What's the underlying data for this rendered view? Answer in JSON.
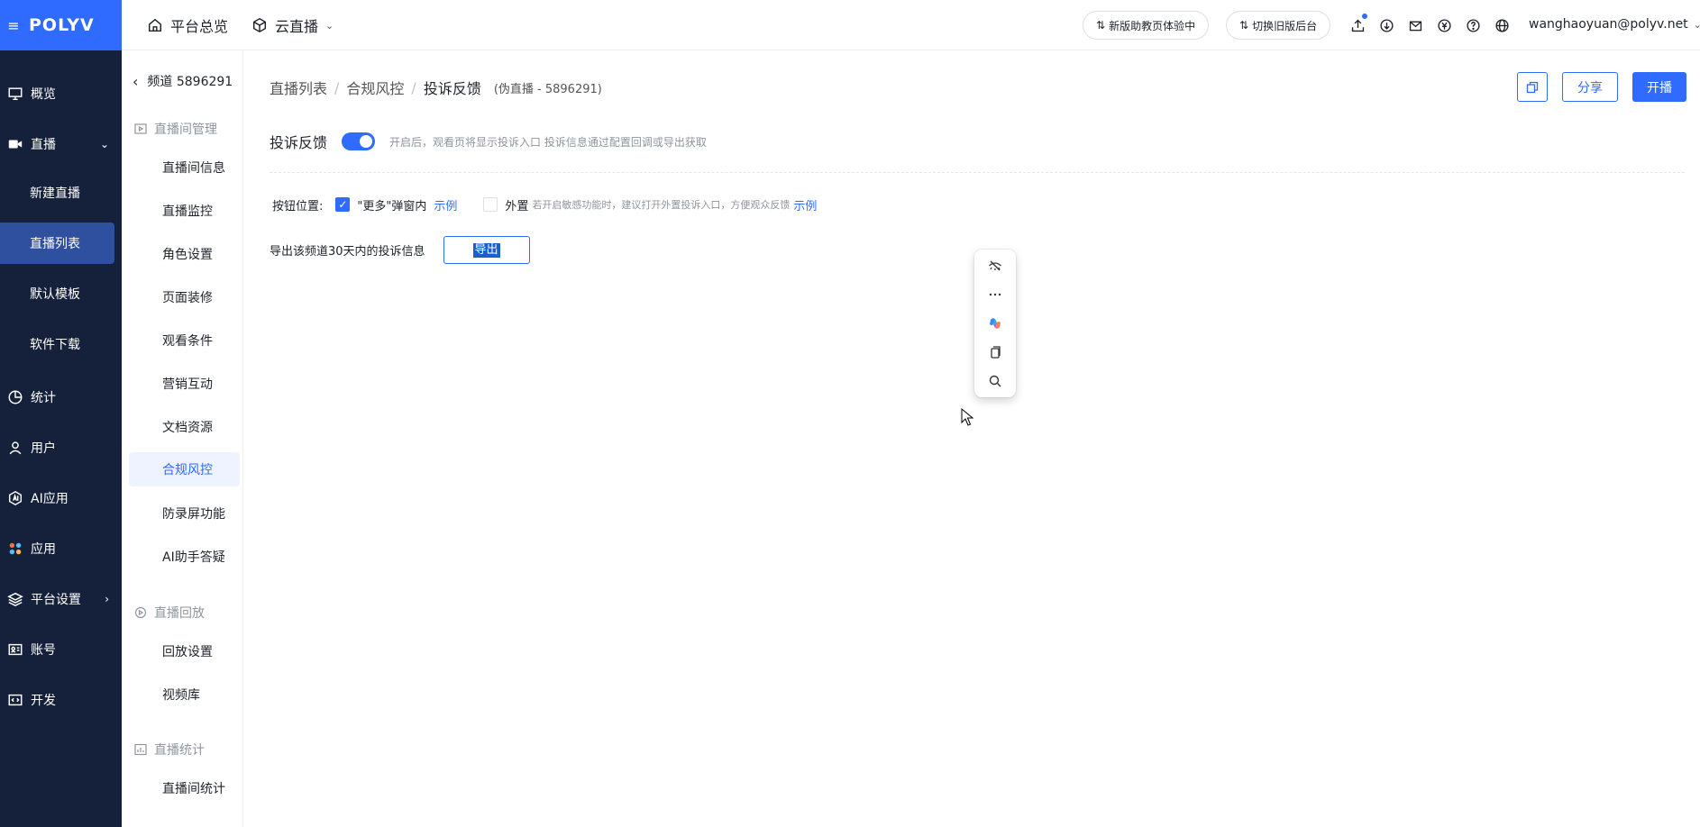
{
  "topbar": {
    "brand": "POLYV",
    "nav": [
      {
        "label": "平台总览",
        "icon": "home-icon"
      },
      {
        "label": "云直播",
        "icon": "cube-icon"
      }
    ],
    "new_ui_label": "新版助教页体验中",
    "old_ui_label": "切换旧版后台",
    "user": "wanghaoyuan@polyv.net"
  },
  "sidebar": {
    "items": [
      {
        "label": "概览"
      },
      {
        "label": "直播"
      },
      {
        "label": "新建直播"
      },
      {
        "label": "直播列表"
      },
      {
        "label": "默认模板"
      },
      {
        "label": "软件下载"
      },
      {
        "label": "统计"
      },
      {
        "label": "用户"
      },
      {
        "label": "AI应用"
      },
      {
        "label": "应用"
      },
      {
        "label": "平台设置"
      },
      {
        "label": "账号"
      },
      {
        "label": "开发"
      }
    ]
  },
  "submenu": {
    "back_label": "频道 5896291",
    "groups": [
      {
        "title": "直播间管理",
        "items": [
          "直播间信息",
          "直播监控",
          "角色设置",
          "页面装修",
          "观看条件",
          "营销互动",
          "文档资源",
          "合规风控",
          "防录屏功能",
          "AI助手答疑"
        ]
      },
      {
        "title": "直播回放",
        "items": [
          "回放设置",
          "视频库"
        ]
      },
      {
        "title": "直播统计",
        "items": [
          "直播间统计"
        ]
      }
    ]
  },
  "breadcrumb": {
    "items": [
      "直播列表",
      "合规风控",
      "投诉反馈"
    ],
    "separator": "/",
    "channel": "(伪直播 - 5896291)"
  },
  "header_buttons": {
    "share": "分享",
    "start": "开播"
  },
  "feedback": {
    "title": "投诉反馈",
    "enabled": true,
    "hint": "开启后，观看页将显示投诉入口 投诉信息通过配置回调或导出获取"
  },
  "button_position": {
    "label": "按钮位置:",
    "option_inner": {
      "label": "\"更多\"弹窗内",
      "checked": true,
      "link": "示例"
    },
    "option_outer": {
      "label": "外置",
      "checked": false,
      "hint": "若开启敏感功能时，建议打开外置投诉入口，方便观众反馈",
      "link": "示例"
    }
  },
  "export": {
    "label": "导出该频道30天内的投诉信息",
    "button": "导出"
  },
  "colors": {
    "primary": "#2f6bff",
    "sidebar_bg": "#15203a",
    "sidebar_active": "#2f4f9f"
  }
}
